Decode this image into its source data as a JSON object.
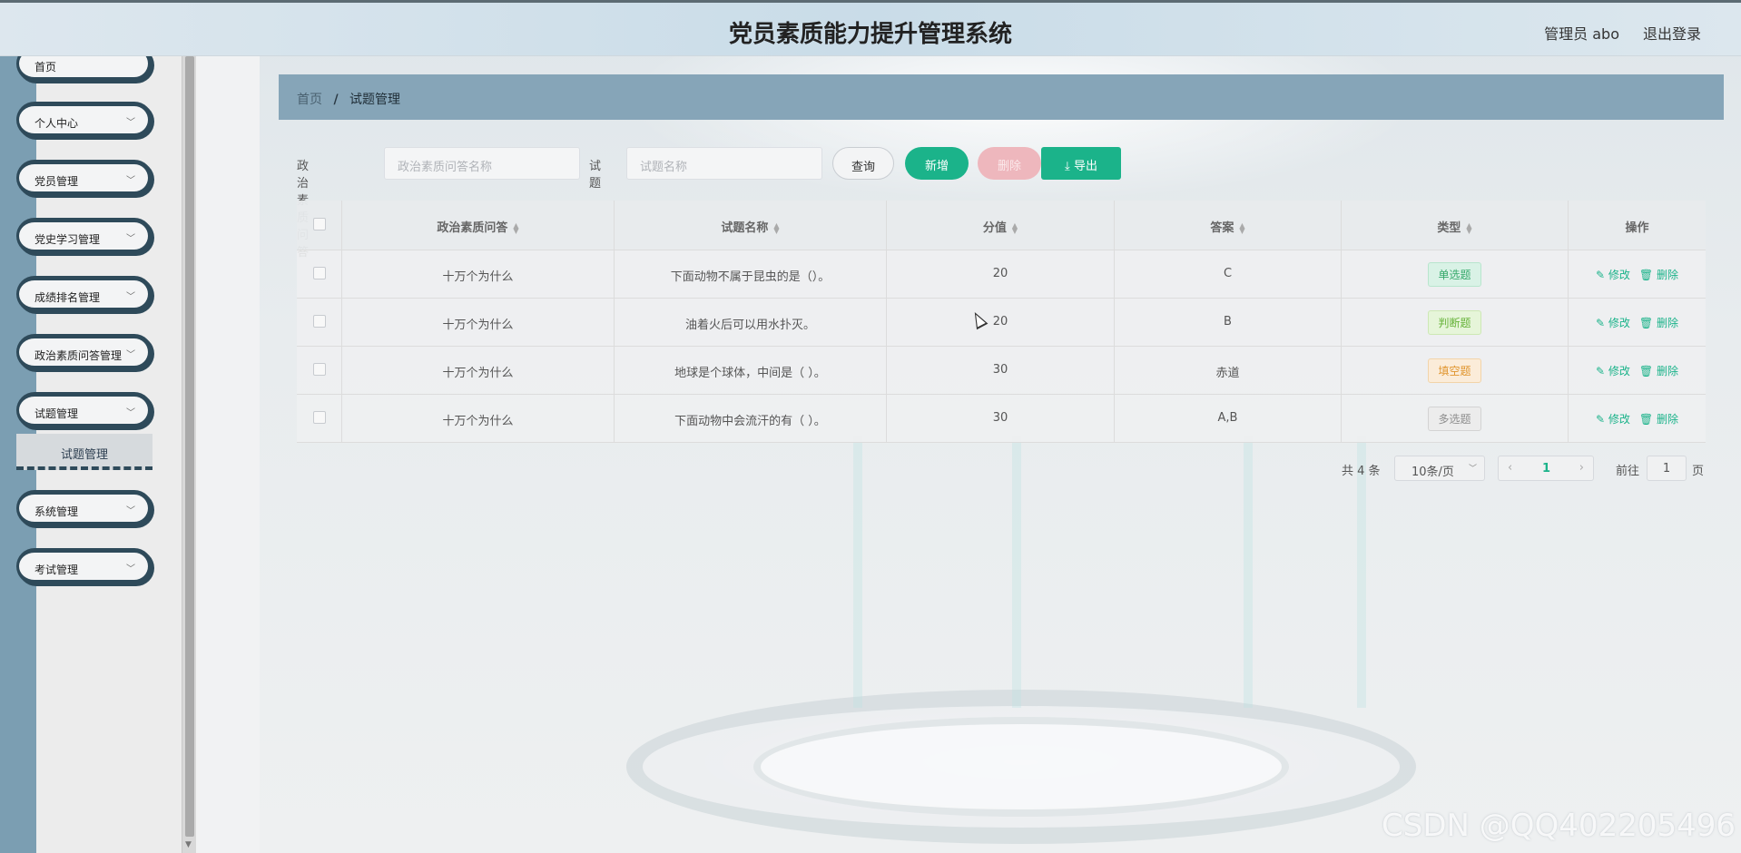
{
  "app": {
    "title": "党员素质能力提升管理系统",
    "user": "管理员 abo",
    "logout": "退出登录"
  },
  "sidebar": {
    "items": [
      {
        "label": "首页"
      },
      {
        "label": "个人中心"
      },
      {
        "label": "党员管理"
      },
      {
        "label": "党史学习管理"
      },
      {
        "label": "成绩排名管理"
      },
      {
        "label": "政治素质问答管理"
      },
      {
        "label": "试题管理"
      },
      {
        "label": "系统管理"
      },
      {
        "label": "考试管理"
      }
    ],
    "submenu_label": "试题管理"
  },
  "breadcrumb": {
    "home": "首页",
    "separator": "/",
    "current": "试题管理"
  },
  "search": {
    "label1": "政治素质问答",
    "placeholder1": "政治素质问答名称",
    "label2": "试题",
    "placeholder2": "试题名称",
    "query_btn": "查询",
    "add_btn": "新增",
    "delete_btn": "删除",
    "export_btn": "导出"
  },
  "table": {
    "headers": [
      "政治素质问答",
      "试题名称",
      "分值",
      "答案",
      "类型",
      "操作"
    ],
    "rows": [
      {
        "qa": "十万个为什么",
        "name": "下面动物不属于昆虫的是（）。",
        "score": "20",
        "answer": "C",
        "type": "单选题"
      },
      {
        "qa": "十万个为什么",
        "name": "油着火后可以用水扑灭。",
        "score": "20",
        "answer": "B",
        "type": "判断题"
      },
      {
        "qa": "十万个为什么",
        "name": "地球是个球体，中间是（ ）。",
        "score": "30",
        "answer": "赤道",
        "type": "填空题"
      },
      {
        "qa": "十万个为什么",
        "name": "下面动物中会流汗的有（ ）。",
        "score": "30",
        "answer": "A,B",
        "type": "多选题"
      }
    ],
    "edit_label": "修改",
    "delete_label": "删除"
  },
  "pagination": {
    "total": "共 4 条",
    "page_size": "10条/页",
    "current_page": "1",
    "goto_label": "前往",
    "goto_value": "1",
    "page_suffix": "页"
  },
  "watermark": "CSDN @QQ402205496"
}
